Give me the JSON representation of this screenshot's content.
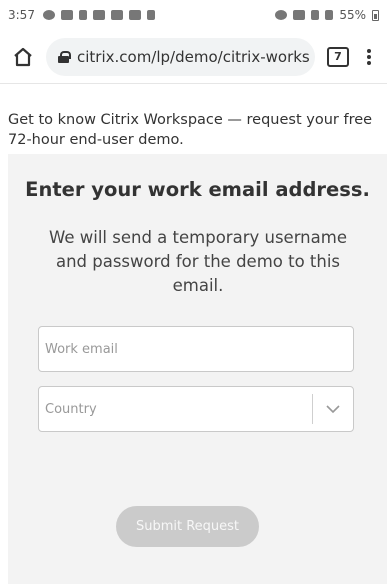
{
  "status_bar": {
    "time": "3:57",
    "battery": "55%",
    "icons_left": [
      "data-saver-icon",
      "calendar-icon",
      "pandora-icon",
      "gmail-icon",
      "linkedin-icon",
      "news-icon",
      "play-icon"
    ],
    "icons_right": [
      "alarm-icon",
      "wifi-icon",
      "signal-icon",
      "signal-icon",
      "battery-icon"
    ]
  },
  "browser": {
    "url": "citrix.com/lp/demo/citrix-works",
    "tab_count": "7"
  },
  "page": {
    "intro": "Get to know Citrix Workspace — request your free 72-hour end-user demo.",
    "form": {
      "title": "Enter your work email address.",
      "subtitle": "We will send a temporary username and password for the demo to this email.",
      "email_placeholder": "Work email",
      "country_placeholder": "Country",
      "submit_label": "Submit Request"
    }
  }
}
